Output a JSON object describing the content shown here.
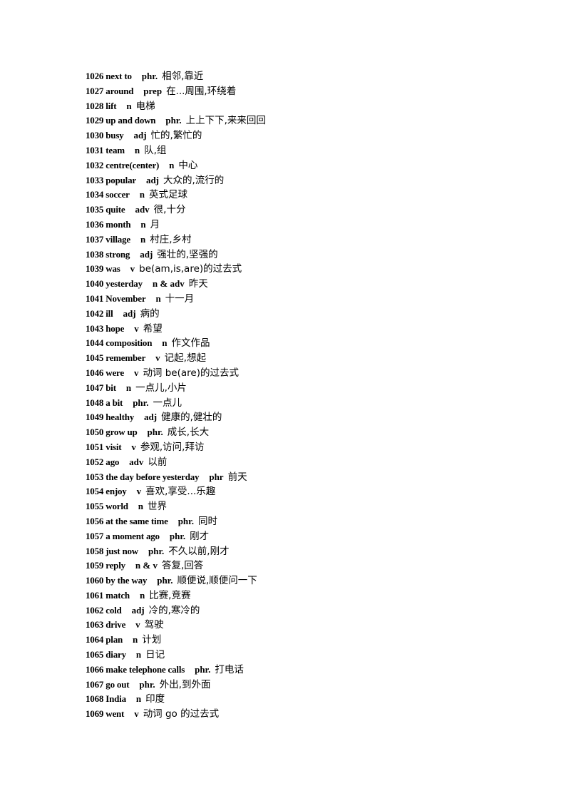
{
  "entries": [
    {
      "num": "1026",
      "word": "next to",
      "pos": "phr.",
      "meaning": "相邻,靠近"
    },
    {
      "num": "1027",
      "word": "around",
      "pos": "prep",
      "meaning": "在...周围,环绕着"
    },
    {
      "num": "1028",
      "word": "lift",
      "pos": "n",
      "meaning": "电梯"
    },
    {
      "num": "1029",
      "word": "up and down",
      "pos": "phr.",
      "meaning": "上上下下,来来回回"
    },
    {
      "num": "1030",
      "word": "busy",
      "pos": "adj",
      "meaning": "忙的,繁忙的"
    },
    {
      "num": "1031",
      "word": "team",
      "pos": "n",
      "meaning": "队,组"
    },
    {
      "num": "1032",
      "word": "centre(center)",
      "pos": "n",
      "meaning": "中心"
    },
    {
      "num": "1033",
      "word": "popular",
      "pos": "adj",
      "meaning": "大众的,流行的"
    },
    {
      "num": "1034",
      "word": "soccer",
      "pos": "n",
      "meaning": "英式足球"
    },
    {
      "num": "1035",
      "word": "quite",
      "pos": "adv",
      "meaning": "很,十分"
    },
    {
      "num": "1036",
      "word": "month",
      "pos": "n",
      "meaning": "月"
    },
    {
      "num": "1037",
      "word": "village",
      "pos": "n",
      "meaning": "村庄,乡村"
    },
    {
      "num": "1038",
      "word": "strong",
      "pos": "adj",
      "meaning": "强壮的,坚强的"
    },
    {
      "num": "1039",
      "word": "was",
      "pos": "v",
      "meaning": "be(am,is,are)的过去式"
    },
    {
      "num": "1040",
      "word": "yesterday",
      "pos": "n & adv",
      "meaning": "昨天"
    },
    {
      "num": "1041",
      "word": "November",
      "pos": "n",
      "meaning": "十一月"
    },
    {
      "num": "1042",
      "word": "ill",
      "pos": "adj",
      "meaning": "病的"
    },
    {
      "num": "1043",
      "word": "hope",
      "pos": "v",
      "meaning": "希望"
    },
    {
      "num": "1044",
      "word": "composition",
      "pos": "n",
      "meaning": "作文作品"
    },
    {
      "num": "1045",
      "word": "remember",
      "pos": "v",
      "meaning": "记起,想起"
    },
    {
      "num": "1046",
      "word": "were",
      "pos": "v",
      "meaning": "动词 be(are)的过去式"
    },
    {
      "num": "1047",
      "word": "bit",
      "pos": "n",
      "meaning": "一点儿,小片"
    },
    {
      "num": "1048",
      "word": "a bit",
      "pos": "phr.",
      "meaning": "一点儿"
    },
    {
      "num": "1049",
      "word": "healthy",
      "pos": "adj",
      "meaning": "健康的,健壮的"
    },
    {
      "num": "1050",
      "word": "grow up",
      "pos": "phr.",
      "meaning": "成长,长大"
    },
    {
      "num": "1051",
      "word": "visit",
      "pos": "v",
      "meaning": "参观,访问,拜访"
    },
    {
      "num": "1052",
      "word": "ago",
      "pos": "adv",
      "meaning": "以前"
    },
    {
      "num": "1053",
      "word": "the day before yesterday",
      "pos": "phr",
      "meaning": "前天"
    },
    {
      "num": "1054",
      "word": "enjoy",
      "pos": "v",
      "meaning": "喜欢,享受...乐趣"
    },
    {
      "num": "1055",
      "word": "world",
      "pos": "n",
      "meaning": "世界"
    },
    {
      "num": "1056",
      "word": "at the same time",
      "pos": "phr.",
      "meaning": "同时"
    },
    {
      "num": "1057",
      "word": "a moment ago",
      "pos": "phr.",
      "meaning": "刚才"
    },
    {
      "num": "1058",
      "word": "just now",
      "pos": "phr.",
      "meaning": "不久以前,刚才"
    },
    {
      "num": "1059",
      "word": "reply",
      "pos": "n & v",
      "meaning": "答复,回答"
    },
    {
      "num": "1060",
      "word": "by the way",
      "pos": "phr.",
      "meaning": "顺便说,顺便问一下"
    },
    {
      "num": "1061",
      "word": "match",
      "pos": "n",
      "meaning": "比赛,竞赛"
    },
    {
      "num": "1062",
      "word": "cold",
      "pos": "adj",
      "meaning": "冷的,寒冷的"
    },
    {
      "num": "1063",
      "word": "drive",
      "pos": "v",
      "meaning": "驾驶"
    },
    {
      "num": "1064",
      "word": "plan",
      "pos": "n",
      "meaning": "计划"
    },
    {
      "num": "1065",
      "word": "diary",
      "pos": "n",
      "meaning": "日记"
    },
    {
      "num": "1066",
      "word": "make telephone calls",
      "pos": "phr.",
      "meaning": "打电话"
    },
    {
      "num": "1067",
      "word": "go out",
      "pos": "phr.",
      "meaning": "外出,到外面"
    },
    {
      "num": "1068",
      "word": "India",
      "pos": "n",
      "meaning": "印度"
    },
    {
      "num": "1069",
      "word": "went",
      "pos": "v",
      "meaning": "动词 go 的过去式"
    }
  ]
}
